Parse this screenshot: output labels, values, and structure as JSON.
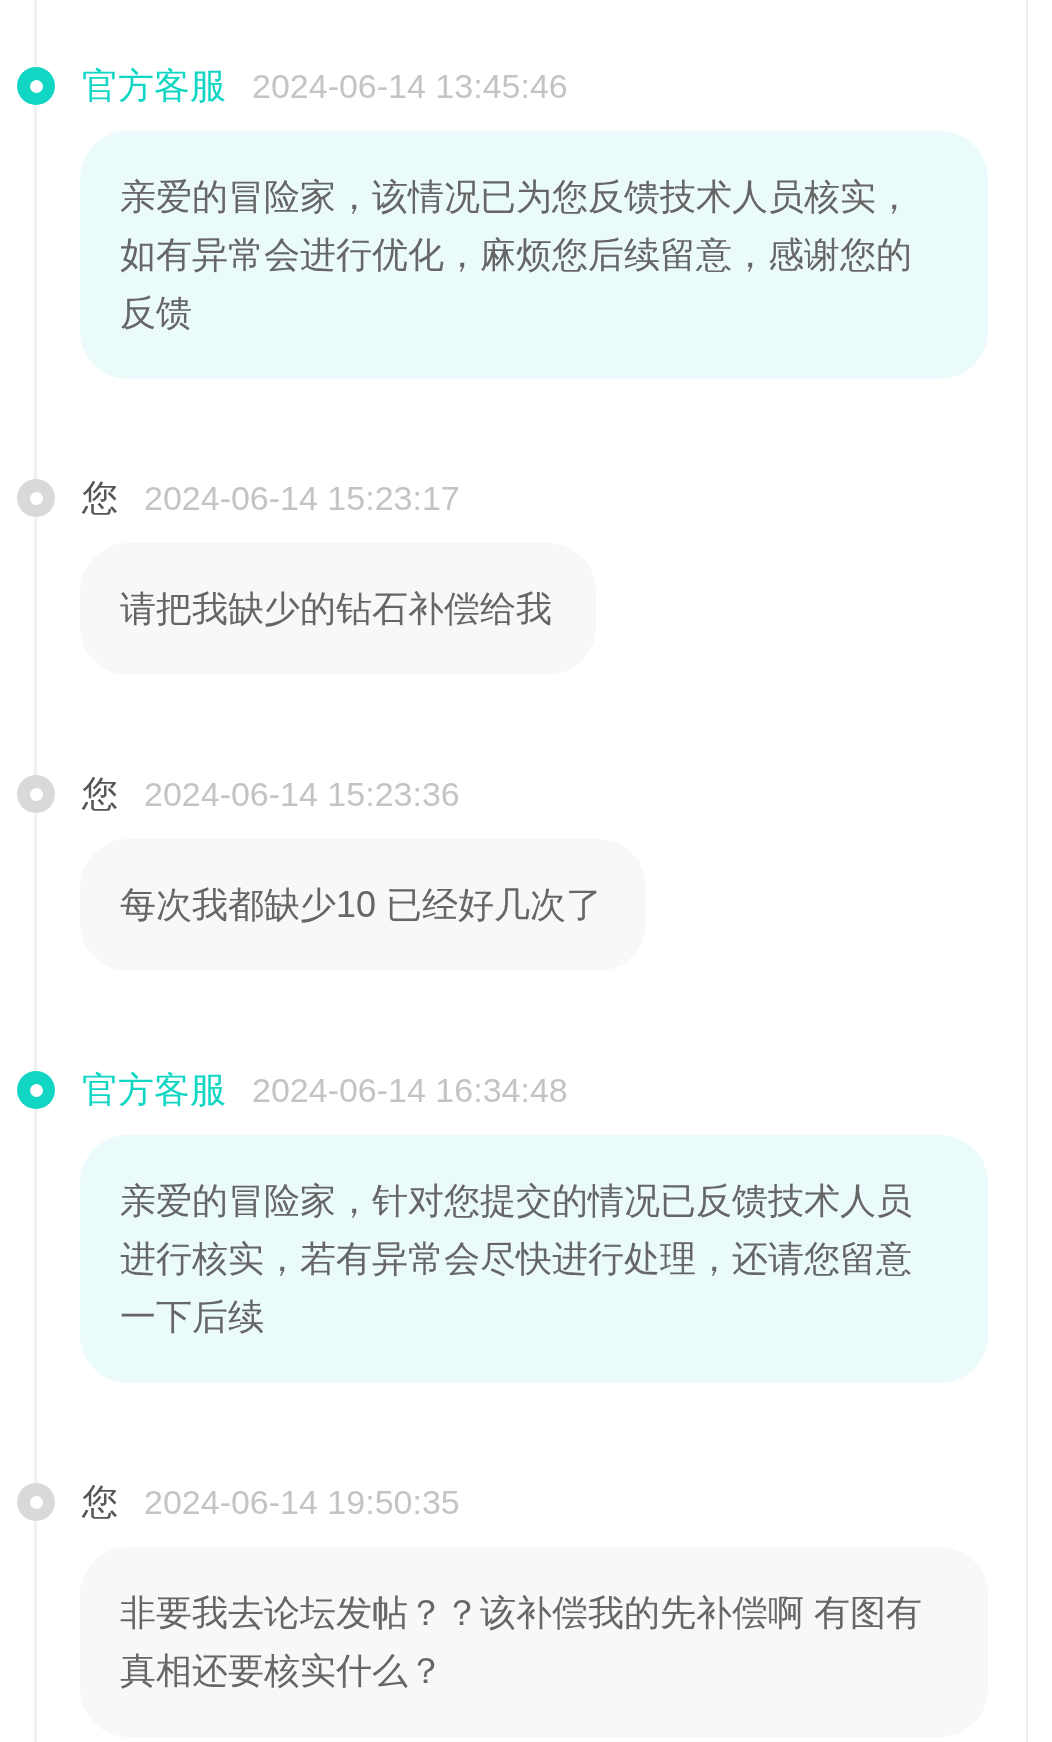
{
  "messages": [
    {
      "kind": "staff",
      "sender": "官方客服",
      "time": "2024-06-14 13:45:46",
      "text": "亲爱的冒险家，该情况已为您反馈技术人员核实，如有异常会进行优化，麻烦您后续留意，感谢您的反馈"
    },
    {
      "kind": "user",
      "sender": "您",
      "time": "2024-06-14 15:23:17",
      "text": "请把我缺少的钻石补偿给我"
    },
    {
      "kind": "user",
      "sender": "您",
      "time": "2024-06-14 15:23:36",
      "text": "每次我都缺少10 已经好几次了"
    },
    {
      "kind": "staff",
      "sender": "官方客服",
      "time": "2024-06-14 16:34:48",
      "text": "亲爱的冒险家，针对您提交的情况已反馈技术人员进行核实，若有异常会尽快进行处理，还请您留意一下后续"
    },
    {
      "kind": "user",
      "sender": "您",
      "time": "2024-06-14 19:50:35",
      "text": "非要我去论坛发帖？？该补偿我的先补偿啊 有图有真相还要核实什么？"
    }
  ]
}
